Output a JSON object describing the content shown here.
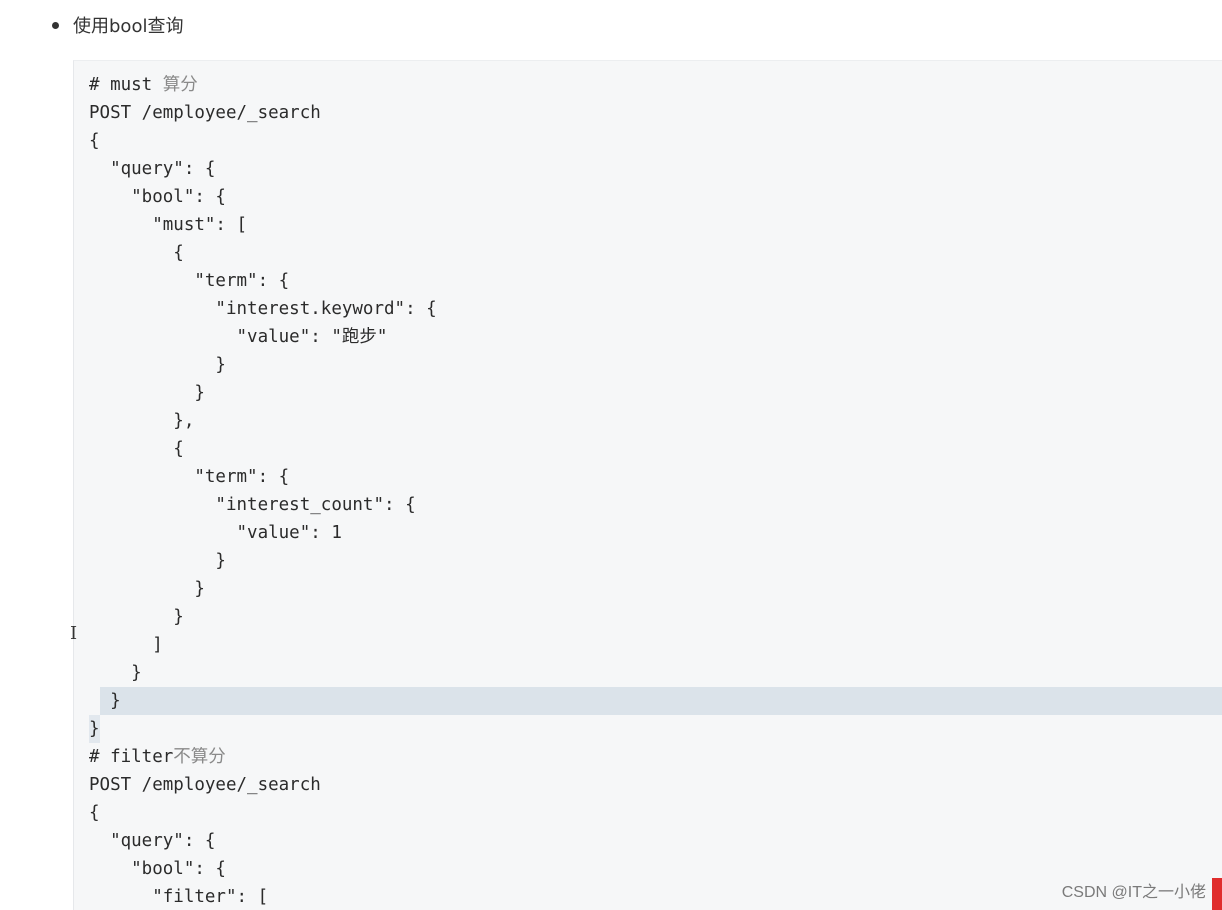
{
  "heading": {
    "bullet_text": "使用bool查询"
  },
  "code_lines": [
    {
      "text": "# must ",
      "comment": "算分"
    },
    {
      "text": "POST /employee/_search"
    },
    {
      "text": "{"
    },
    {
      "text": "  \"query\": {"
    },
    {
      "text": "    \"bool\": {"
    },
    {
      "text": "      \"must\": ["
    },
    {
      "text": "        {"
    },
    {
      "text": "          \"term\": {"
    },
    {
      "text": "            \"interest.keyword\": {"
    },
    {
      "text": "              \"value\": \"跑步\""
    },
    {
      "text": "            }"
    },
    {
      "text": "          }"
    },
    {
      "text": "        },"
    },
    {
      "text": "        {"
    },
    {
      "text": "          \"term\": {"
    },
    {
      "text": "            \"interest_count\": {"
    },
    {
      "text": "              \"value\": 1"
    },
    {
      "text": "            }"
    },
    {
      "text": "          }"
    },
    {
      "text": "        }"
    },
    {
      "text": "      ]"
    },
    {
      "text": "    }"
    },
    {
      "text": "  }",
      "highlight": true
    },
    {
      "text": "}",
      "closing": true
    },
    {
      "text": "# filter",
      "comment": "不算分"
    },
    {
      "text": "POST /employee/_search"
    },
    {
      "text": "{"
    },
    {
      "text": "  \"query\": {"
    },
    {
      "text": "    \"bool\": {"
    },
    {
      "text": "      \"filter\": ["
    }
  ],
  "cursor_glyph": "I",
  "watermark": "CSDN @IT之一小佬"
}
